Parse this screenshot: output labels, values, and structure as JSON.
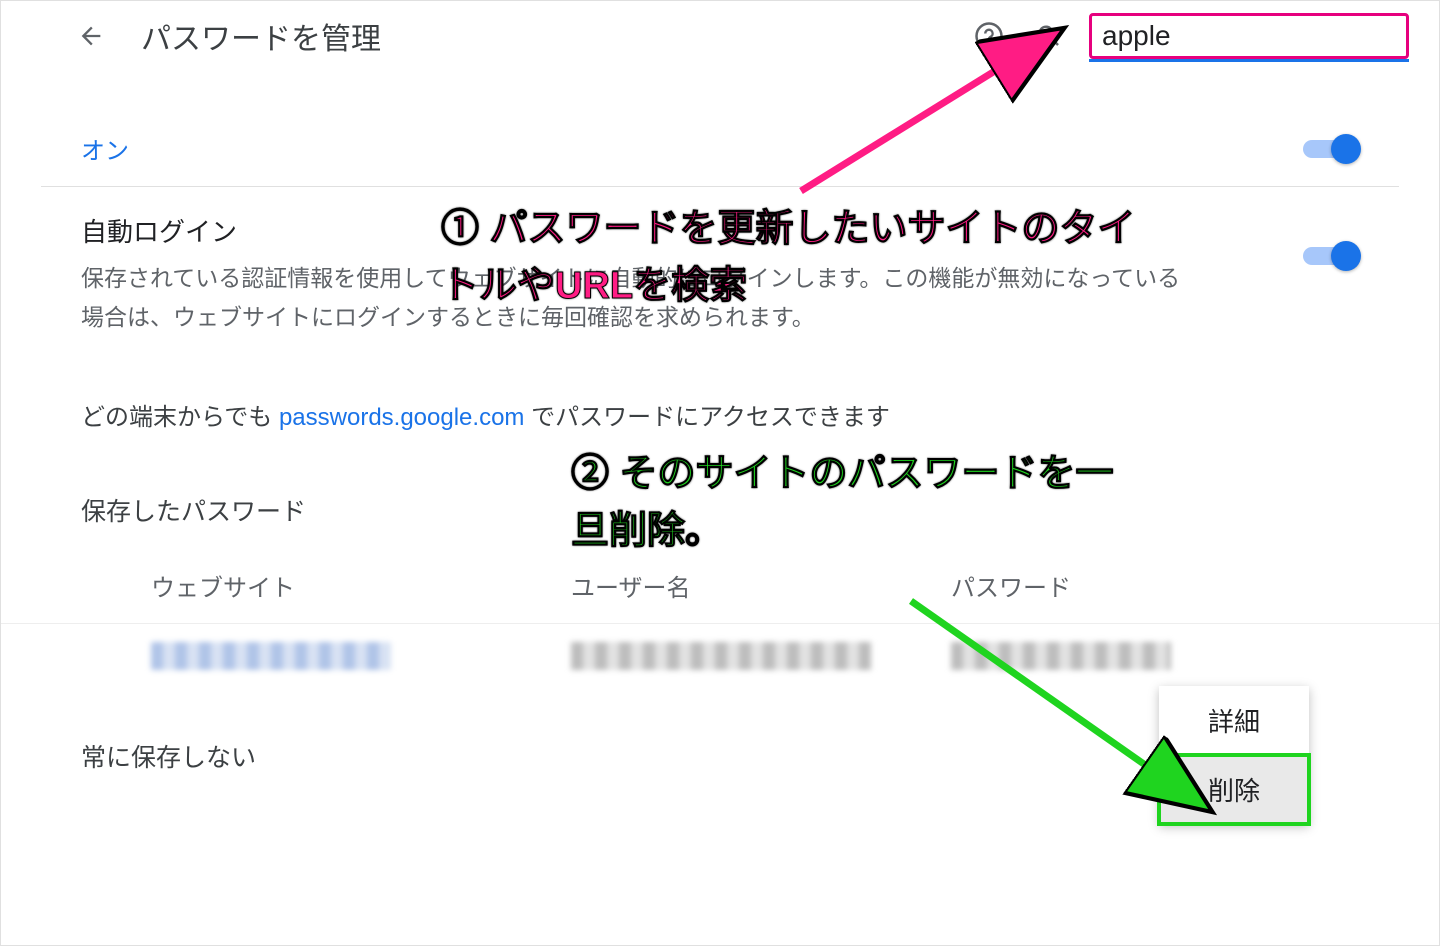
{
  "header": {
    "title": "パスワードを管理",
    "search_value": "apple"
  },
  "toggle_on_label": "オン",
  "auto_login": {
    "title": "自動ログイン",
    "description": "保存されている認証情報を使用してウェブサイトに自動的にログインします。この機能が無効になっている場合は、ウェブサイトにログインするときに毎回確認を求められます。"
  },
  "access_note": {
    "prefix": "どの端末からでも ",
    "link_text": "passwords.google.com",
    "suffix": " でパスワードにアクセスできます"
  },
  "saved_section_title": "保存したパスワード",
  "columns": {
    "site": "ウェブサイト",
    "user": "ユーザー名",
    "pass": "パスワード"
  },
  "context_menu": {
    "details": "詳細",
    "delete": "削除"
  },
  "never_save_title": "常に保存しない",
  "annotations": {
    "step1": "① パスワードを更新したいサイトのタイトルやURLを検索",
    "step2": "② そのサイトのパスワードを一旦削除。"
  }
}
